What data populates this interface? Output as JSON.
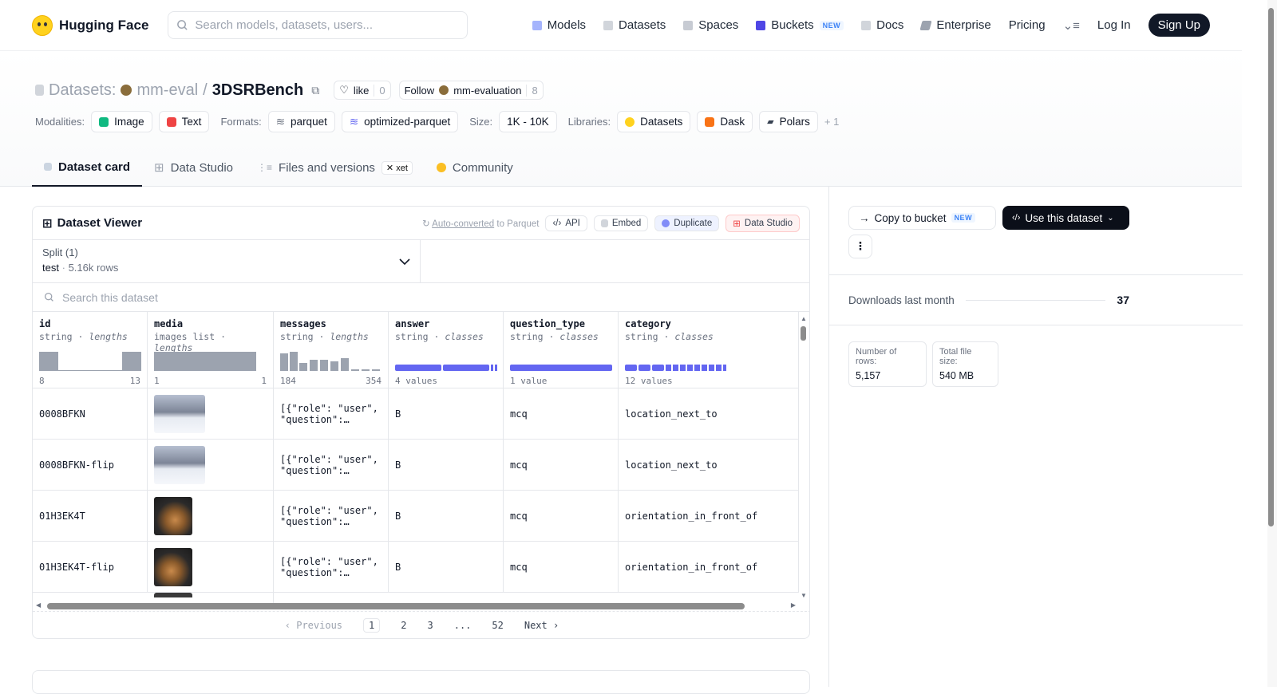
{
  "brand": {
    "name": "Hugging Face"
  },
  "search": {
    "placeholder": "Search models, datasets, users..."
  },
  "nav": {
    "models": "Models",
    "datasets": "Datasets",
    "spaces": "Spaces",
    "buckets": "Buckets",
    "buckets_badge": "NEW",
    "docs": "Docs",
    "enterprise": "Enterprise",
    "pricing": "Pricing",
    "login": "Log In",
    "signup": "Sign Up"
  },
  "repo": {
    "type_label": "Datasets:",
    "owner": "mm-eval",
    "separator": "/",
    "name": "3DSRBench",
    "like_label": "like",
    "like_count": "0",
    "follow_label": "Follow",
    "follow_org": "mm-evaluation",
    "follow_count": "8"
  },
  "meta": {
    "modalities_label": "Modalities:",
    "modalities": [
      "Image",
      "Text"
    ],
    "formats_label": "Formats:",
    "formats": [
      "parquet",
      "optimized-parquet"
    ],
    "size_label": "Size:",
    "size": "1K - 10K",
    "libraries_label": "Libraries:",
    "libraries": [
      "Datasets",
      "Dask",
      "Polars"
    ],
    "libraries_more": "+ 1"
  },
  "tabs": {
    "card": "Dataset card",
    "studio": "Data Studio",
    "files": "Files and versions",
    "files_badge": "xet",
    "community": "Community"
  },
  "viewer": {
    "title": "Dataset Viewer",
    "auto": "Auto-converted",
    "auto_suffix": "to Parquet",
    "api": "API",
    "embed": "Embed",
    "duplicate": "Duplicate",
    "studio": "Data Studio",
    "split_label": "Split (1)",
    "split_name": "test",
    "split_rows": "5.16k rows",
    "search_placeholder": "Search this dataset"
  },
  "columns": [
    {
      "name": "id",
      "type": "string",
      "stat": "lengths",
      "min": "8",
      "max": "13"
    },
    {
      "name": "media",
      "type": "images list",
      "stat": "lengths",
      "min": "1",
      "max": "1"
    },
    {
      "name": "messages",
      "type": "string",
      "stat": "lengths",
      "min": "184",
      "max": "354"
    },
    {
      "name": "answer",
      "type": "string",
      "stat": "classes",
      "summary": "4 values"
    },
    {
      "name": "question_type",
      "type": "string",
      "stat": "classes",
      "summary": "1 value"
    },
    {
      "name": "category",
      "type": "string",
      "stat": "classes",
      "summary": "12 values"
    }
  ],
  "rows": [
    {
      "id": "0008BFKN",
      "messages_1": "[{\"role\": \"user\",",
      "messages_2": "\"question\":…",
      "answer": "B",
      "question_type": "mcq",
      "category": "location_next_to"
    },
    {
      "id": "0008BFKN-flip",
      "messages_1": "[{\"role\": \"user\",",
      "messages_2": "\"question\":…",
      "answer": "B",
      "question_type": "mcq",
      "category": "location_next_to"
    },
    {
      "id": "01H3EK4T",
      "messages_1": "[{\"role\": \"user\",",
      "messages_2": "\"question\":…",
      "answer": "B",
      "question_type": "mcq",
      "category": "orientation_in_front_of"
    },
    {
      "id": "01H3EK4T-flip",
      "messages_1": "[{\"role\": \"user\",",
      "messages_2": "\"question\":…",
      "answer": "B",
      "question_type": "mcq",
      "category": "orientation_in_front_of"
    }
  ],
  "pager": {
    "prev": "Previous",
    "pages": [
      "1",
      "2",
      "3",
      "...",
      "52"
    ],
    "next": "Next"
  },
  "side": {
    "copy_bucket": "Copy to bucket",
    "copy_badge": "NEW",
    "use_dataset": "Use this dataset",
    "downloads_label": "Downloads last month",
    "downloads": "37",
    "rows_label": "Number of rows:",
    "rows_value": "5,157",
    "size_label": "Total file size:",
    "size_value": "540 MB"
  },
  "colors": {
    "accent": "#6366f1",
    "dark": "#111827",
    "red": "#ef4444"
  }
}
